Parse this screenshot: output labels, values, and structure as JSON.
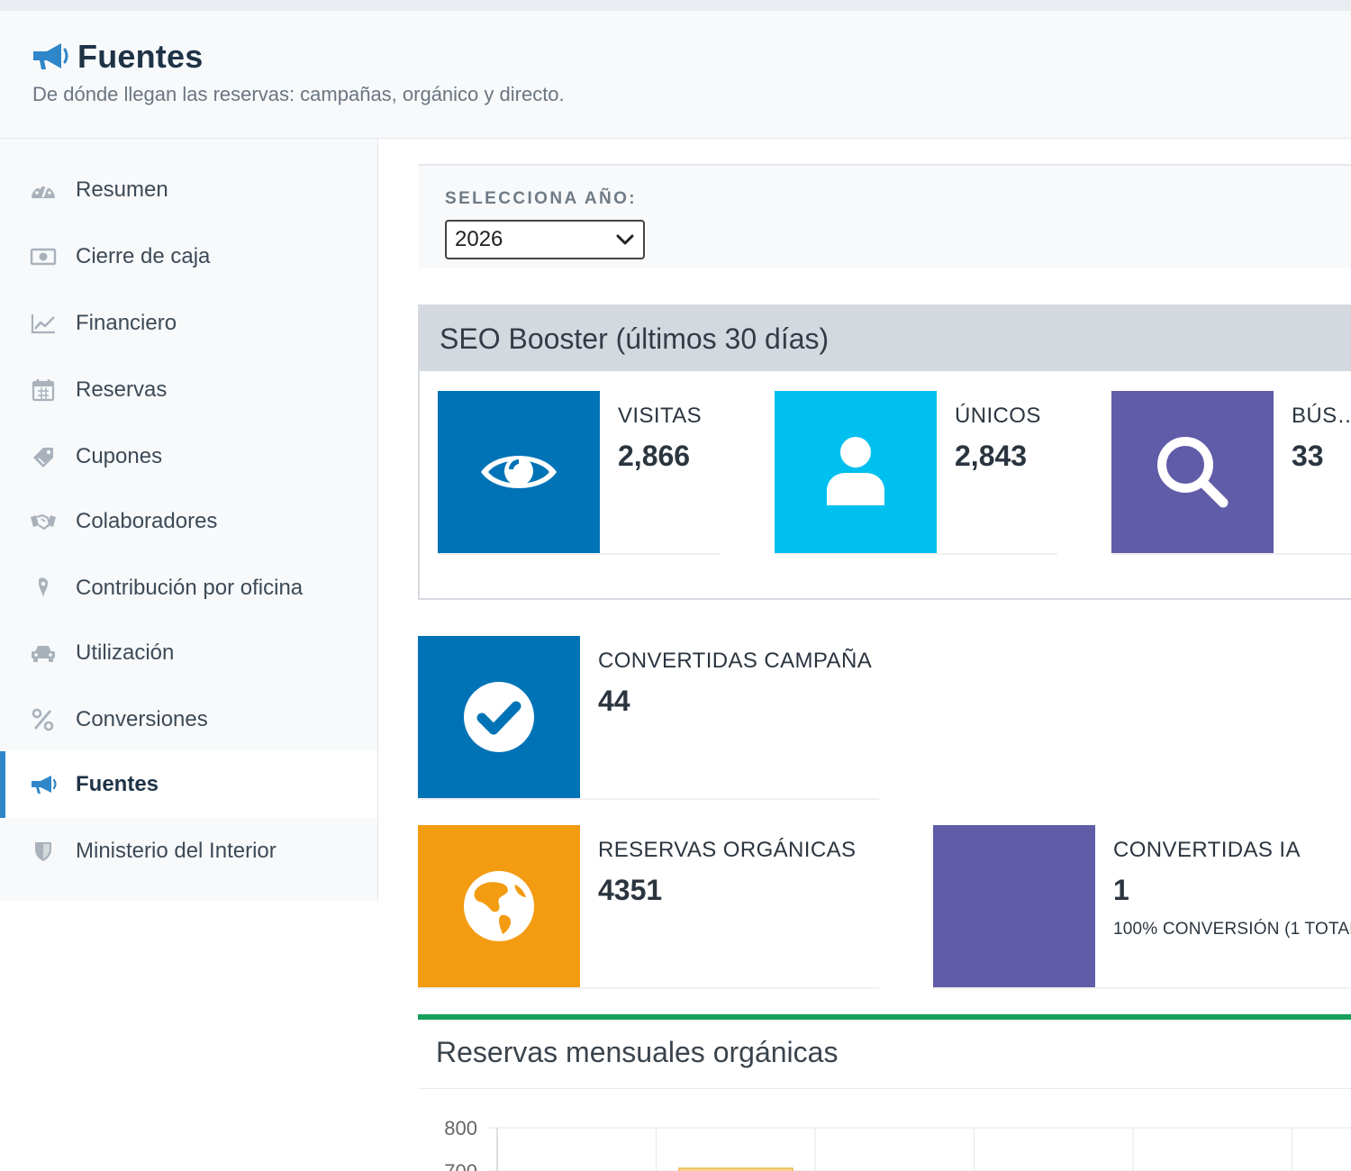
{
  "header": {
    "title": "Fuentes",
    "subtitle": "De dónde llegan las reservas: campañas, orgánico y directo."
  },
  "sidebar": {
    "items": [
      {
        "label": "Resumen",
        "icon": "dashboard-gauge-icon"
      },
      {
        "label": "Cierre de caja",
        "icon": "cash-bill-icon"
      },
      {
        "label": "Financiero",
        "icon": "line-chart-icon"
      },
      {
        "label": "Reservas",
        "icon": "calendar-icon"
      },
      {
        "label": "Cupones",
        "icon": "ticket-tag-icon"
      },
      {
        "label": "Colaboradores",
        "icon": "handshake-icon"
      },
      {
        "label": "Contribución por oficina",
        "icon": "map-pin-icon"
      },
      {
        "label": "Utilización",
        "icon": "car-icon"
      },
      {
        "label": "Conversiones",
        "icon": "percent-icon"
      },
      {
        "label": "Fuentes",
        "icon": "megaphone-icon",
        "active": true
      },
      {
        "label": "Ministerio del Interior",
        "icon": "shield-icon"
      }
    ]
  },
  "year_select": {
    "label": "SELECCIONA AÑO:",
    "value": "2026"
  },
  "seo": {
    "title": "SEO Booster (últimos 30 días)",
    "boxes": [
      {
        "label": "VISITAS",
        "value": "2,866",
        "icon": "eye-icon",
        "color": "#0073b7"
      },
      {
        "label": "ÚNICOS",
        "value": "2,843",
        "icon": "user-icon",
        "color": "#00c0ef"
      },
      {
        "label": "BÚS…",
        "value": "33",
        "icon": "search-icon",
        "color": "#605ca8"
      }
    ]
  },
  "stats": {
    "campaign": {
      "label": "CONVERTIDAS CAMPAÑA",
      "value": "44",
      "icon": "check-circle-icon",
      "color": "#0073b7"
    },
    "organic": {
      "label": "RESERVAS ORGÁNICAS",
      "value": "4351",
      "icon": "globe-americas-icon",
      "color": "#f39c12"
    },
    "ai": {
      "label": "CONVERTIDAS IA",
      "value": "1",
      "note": "100% CONVERSIÓN (1 TOTAL",
      "color": "#605ca8"
    }
  },
  "chart_data": {
    "type": "bar",
    "title": "Reservas mensuales orgánicas",
    "y_ticks": [
      "800",
      "700"
    ],
    "ylim": [
      0,
      800
    ],
    "bar_color": "#f8d58c",
    "categories": [],
    "values": []
  }
}
